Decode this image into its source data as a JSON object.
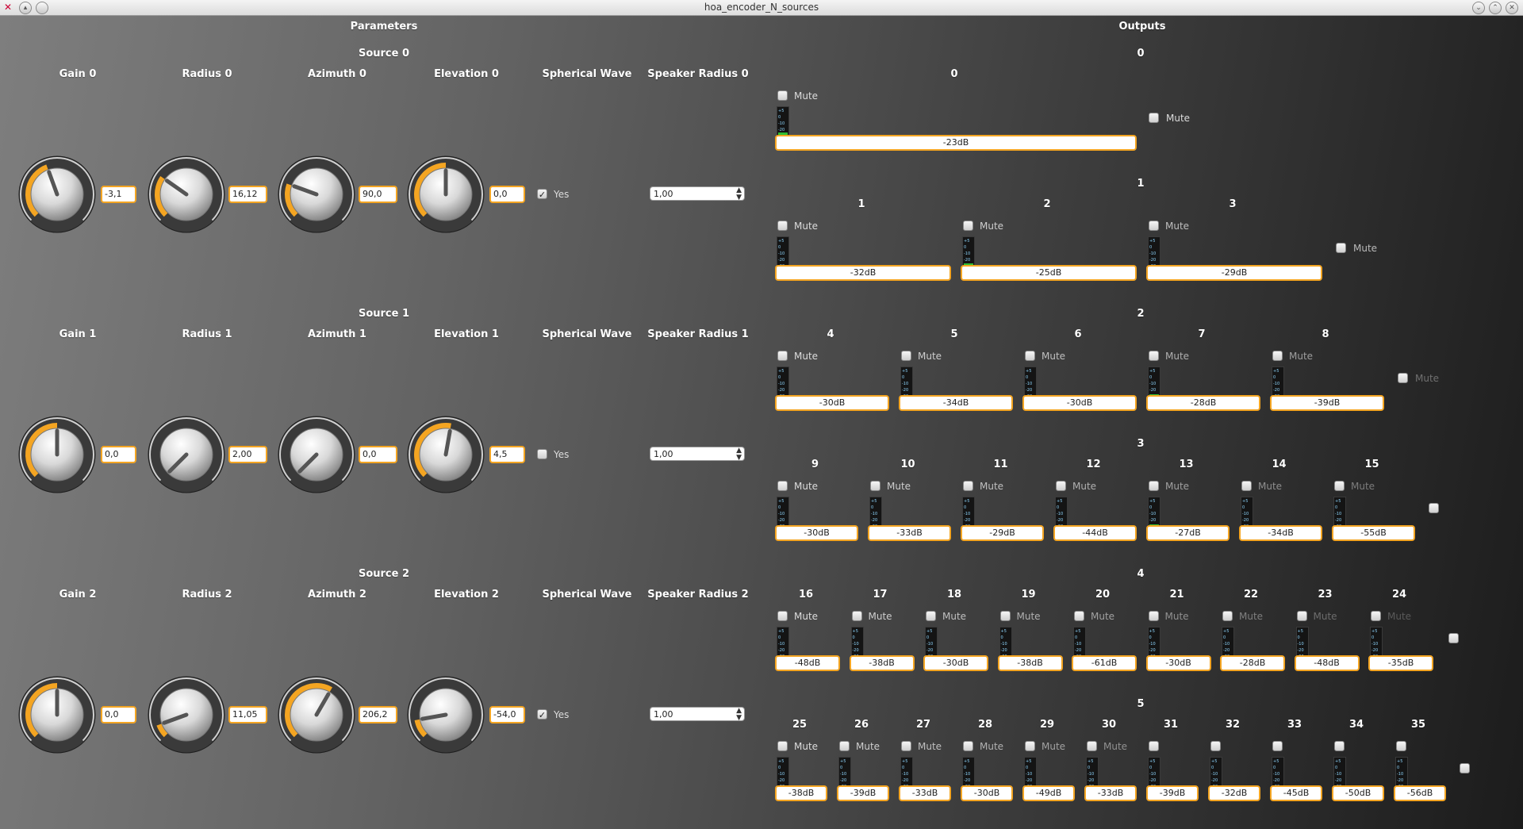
{
  "window": {
    "title": "hoa_encoder_N_sources"
  },
  "colors": {
    "accent": "#f4a522",
    "meter": "#2fbf33"
  },
  "parameters": {
    "heading": "Parameters",
    "sources": [
      {
        "title": "Source  0",
        "gain_label": "Gain  0",
        "radius_label": "Radius  0",
        "azimuth_label": "Azimuth  0",
        "elevation_label": "Elevation  0",
        "spherical_label": "Spherical Wave",
        "speaker_label": "Speaker Radius  0",
        "gain": "-3,1",
        "radius": "16,12",
        "azimuth": "90,0",
        "elevation": "0,0",
        "spherical_checked": true,
        "spherical_text": "Yes",
        "speaker_radius": "1,00"
      },
      {
        "title": "Source  1",
        "gain_label": "Gain  1",
        "radius_label": "Radius  1",
        "azimuth_label": "Azimuth  1",
        "elevation_label": "Elevation  1",
        "spherical_label": "Spherical Wave",
        "speaker_label": "Speaker Radius  1",
        "gain": "0,0",
        "radius": "2,00",
        "azimuth": "0,0",
        "elevation": "4,5",
        "spherical_checked": false,
        "spherical_text": "Yes",
        "speaker_radius": "1,00"
      },
      {
        "title": "Source  2",
        "gain_label": "Gain  2",
        "radius_label": "Radius  2",
        "azimuth_label": "Azimuth  2",
        "elevation_label": "Elevation  2",
        "spherical_label": "Spherical Wave",
        "speaker_label": "Speaker Radius  2",
        "gain": "0,0",
        "radius": "11,05",
        "azimuth": "206,2",
        "elevation": "-54,0",
        "spherical_checked": true,
        "spherical_text": "Yes",
        "speaker_radius": "1,00"
      }
    ]
  },
  "outputs": {
    "heading": "Outputs",
    "mute_label": "Mute",
    "groups": [
      {
        "label": "0",
        "channels": [
          {
            "n": "0",
            "db": "-23dB",
            "level": 0.3
          }
        ]
      },
      {
        "label": "1",
        "channels": [
          {
            "n": "1",
            "db": "-32dB",
            "level": 0.2
          },
          {
            "n": "2",
            "db": "-25dB",
            "level": 0.28
          },
          {
            "n": "3",
            "db": "-29dB",
            "level": 0.22
          }
        ]
      },
      {
        "label": "2",
        "channels": [
          {
            "n": "4",
            "db": "-30dB",
            "level": 0.2
          },
          {
            "n": "5",
            "db": "-34dB",
            "level": 0.18
          },
          {
            "n": "6",
            "db": "-30dB",
            "level": 0.2
          },
          {
            "n": "7",
            "db": "-28dB",
            "level": 0.25
          },
          {
            "n": "8",
            "db": "-39dB",
            "level": 0.15
          }
        ]
      },
      {
        "label": "3",
        "channels": [
          {
            "n": "9",
            "db": "-30dB",
            "level": 0.2
          },
          {
            "n": "10",
            "db": "-33dB",
            "level": 0.2
          },
          {
            "n": "11",
            "db": "-29dB",
            "level": 0.22
          },
          {
            "n": "12",
            "db": "-44dB",
            "level": 0.12
          },
          {
            "n": "13",
            "db": "-27dB",
            "level": 0.26
          },
          {
            "n": "14",
            "db": "-34dB",
            "level": 0.18
          },
          {
            "n": "15",
            "db": "-55dB",
            "level": 0.08
          }
        ]
      },
      {
        "label": "4",
        "channels": [
          {
            "n": "16",
            "db": "-48dB",
            "level": 0.1
          },
          {
            "n": "17",
            "db": "-38dB",
            "level": 0.16
          },
          {
            "n": "18",
            "db": "-30dB",
            "level": 0.2
          },
          {
            "n": "19",
            "db": "-38dB",
            "level": 0.16
          },
          {
            "n": "20",
            "db": "-61dB",
            "level": 0.06
          },
          {
            "n": "21",
            "db": "-30dB",
            "level": 0.2
          },
          {
            "n": "22",
            "db": "-28dB",
            "level": 0.24
          },
          {
            "n": "23",
            "db": "-48dB",
            "level": 0.1
          },
          {
            "n": "24",
            "db": "-35dB",
            "level": 0.17
          }
        ]
      },
      {
        "label": "5",
        "channels": [
          {
            "n": "25",
            "db": "-38dB",
            "level": 0.16
          },
          {
            "n": "26",
            "db": "-39dB",
            "level": 0.15
          },
          {
            "n": "27",
            "db": "-33dB",
            "level": 0.2
          },
          {
            "n": "28",
            "db": "-30dB",
            "level": 0.2
          },
          {
            "n": "29",
            "db": "-49dB",
            "level": 0.1
          },
          {
            "n": "30",
            "db": "-33dB",
            "level": 0.2
          },
          {
            "n": "31",
            "db": "-39dB",
            "level": 0.15
          },
          {
            "n": "32",
            "db": "-32dB",
            "level": 0.2
          },
          {
            "n": "33",
            "db": "-45dB",
            "level": 0.12
          },
          {
            "n": "34",
            "db": "-50dB",
            "level": 0.09
          },
          {
            "n": "35",
            "db": "-56dB",
            "level": 0.08
          }
        ]
      }
    ]
  }
}
